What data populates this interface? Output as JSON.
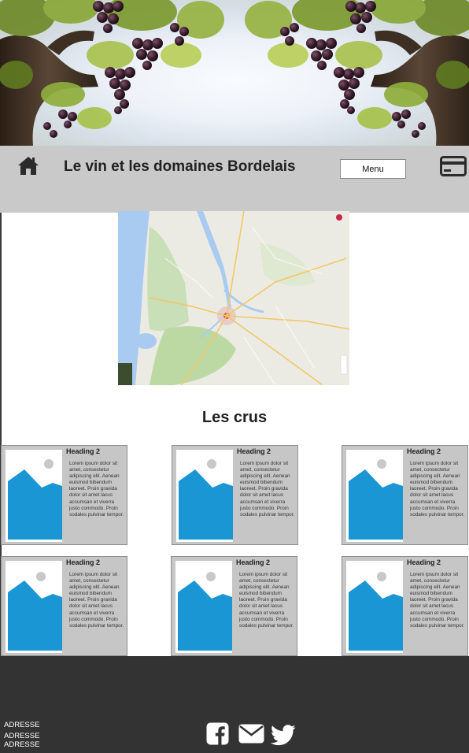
{
  "hero": {
    "image": "vineyard-grapes-photo"
  },
  "navbar": {
    "home_icon": "home-icon",
    "title": "Le vin et les domaines Bordelais",
    "menu_label": "Menu",
    "card_icon": "credit-card-icon"
  },
  "map": {
    "image": "bordeaux-region-map"
  },
  "section": {
    "title": "Les crus"
  },
  "cards": [
    {
      "heading": "Heading 2",
      "body": "Lorem ipsum dolor sit amet, consectetur adipiscing elit. Aenean euismod bibendum laoreet. Proin gravida dolor sit amet lacus accumsan et viverra justo commodo. Proin sodales pulvinar tempor."
    },
    {
      "heading": "Heading 2",
      "body": "Lorem ipsum dolor sit amet, consectetur adipiscing elit. Aenean euismod bibendum laoreet. Proin gravida dolor sit amet lacus accumsan et viverra justo commodo. Proin sodales pulvinar tempor."
    },
    {
      "heading": "Heading 2",
      "body": "Lorem ipsum dolor sit amet, consectetur adipiscing elit. Aenean euismod bibendum laoreet. Proin gravida dolor sit amet lacus accumsan et viverra justo commodo. Proin sodales pulvinar tempor."
    },
    {
      "heading": "Heading 2",
      "body": "Lorem ipsum dolor sit amet, consectetur adipiscing elit. Aenean euismod bibendum laoreet. Proin gravida dolor sit amet lacus accumsan et viverra justo commodo. Proin sodales pulvinar tempor."
    },
    {
      "heading": "Heading 2",
      "body": "Lorem ipsum dolor sit amet, consectetur adipiscing elit. Aenean euismod bibendum laoreet. Proin gravida dolor sit amet lacus accumsan et viverra justo commodo. Proin sodales pulvinar tempor."
    },
    {
      "heading": "Heading 2",
      "body": "Lorem ipsum dolor sit amet, consectetur adipiscing elit. Aenean euismod bibendum laoreet. Proin gravida dolor sit amet lacus accumsan et viverra justo commodo. Proin sodales pulvinar tempor."
    }
  ],
  "footer": {
    "address_lines": [
      "ADRESSE",
      "ADRESSE",
      "ADRESSE"
    ],
    "social": [
      "facebook-icon",
      "mail-icon",
      "twitter-icon"
    ]
  },
  "colors": {
    "navbar_bg": "#c9c9c9",
    "card_bg": "#c6c6c6",
    "footer_bg": "#333333",
    "placeholder_blue": "#1a96d4"
  }
}
